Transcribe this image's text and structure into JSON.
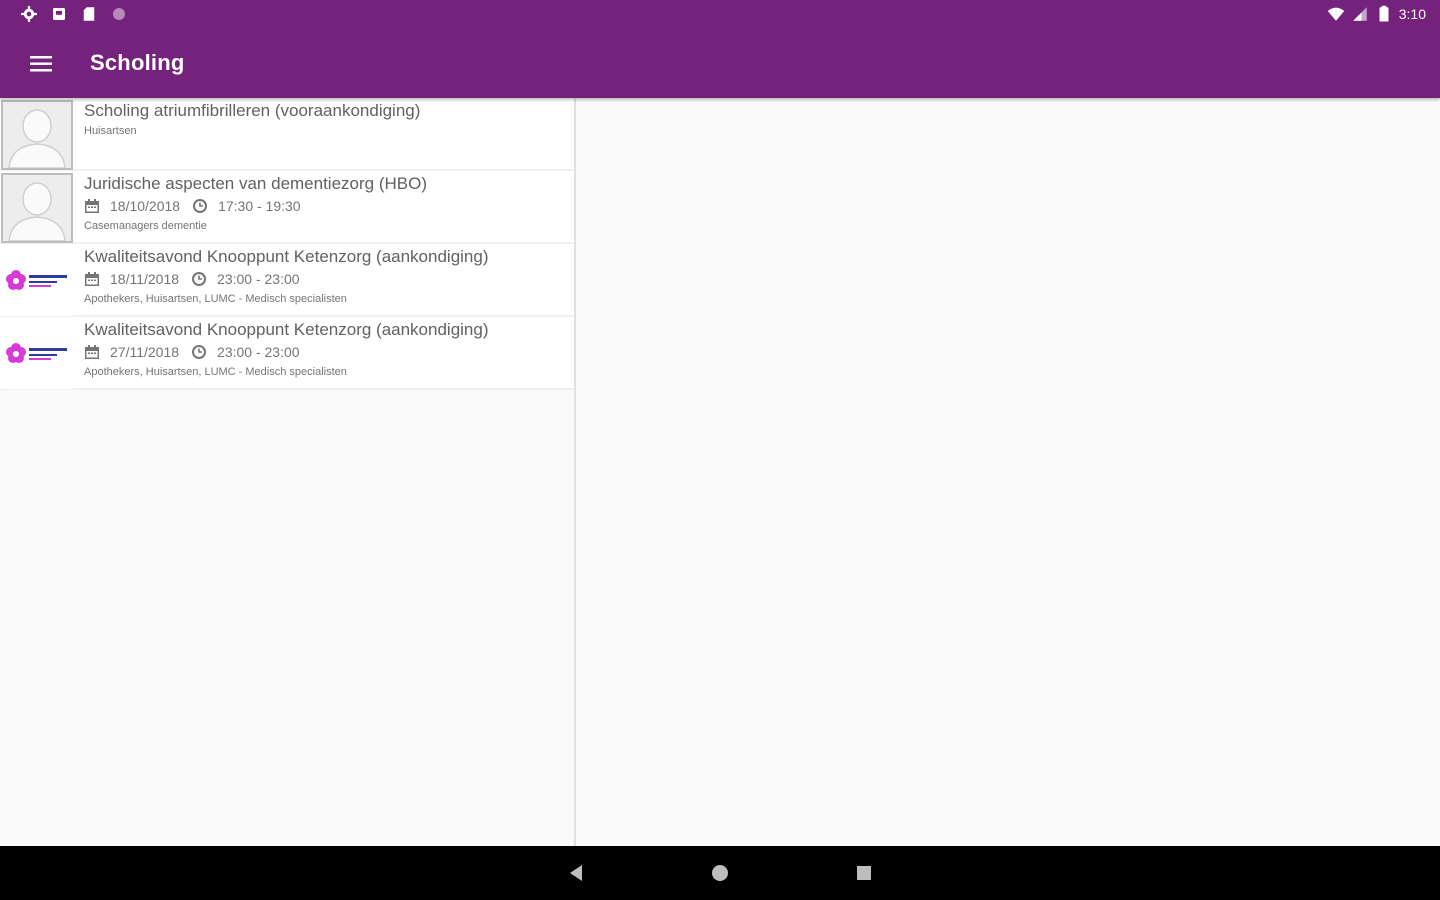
{
  "status_bar": {
    "time": "3:10",
    "left_icons": [
      "settings-icon",
      "notification-icon",
      "sd-card-icon",
      "circle-icon"
    ],
    "right_icons": [
      "wifi-icon",
      "signal-icon",
      "battery-icon"
    ]
  },
  "app_bar": {
    "title": "Scholing",
    "menu_icon": "hamburger-menu-icon"
  },
  "colors": {
    "primary": "#75227c",
    "logo_pink": "#d63bd6",
    "logo_blue": "#2b3c9a"
  },
  "items": [
    {
      "title": "Scholing atriumfibrilleren (vooraankondiging)",
      "date": "",
      "time": "",
      "audience": "Huisartsen",
      "thumbnail": "avatar-placeholder"
    },
    {
      "title": "Juridische aspecten van dementiezorg (HBO)",
      "date": "18/10/2018",
      "time": "17:30 - 19:30",
      "audience": "Casemanagers dementie",
      "thumbnail": "avatar-placeholder"
    },
    {
      "title": "Kwaliteitsavond Knooppunt Ketenzorg (aankondiging)",
      "date": "18/11/2018",
      "time": "23:00 - 23:00",
      "audience": "Apothekers, Huisartsen, LUMC - Medisch specialisten",
      "thumbnail": "knooppunt-logo"
    },
    {
      "title": "Kwaliteitsavond Knooppunt Ketenzorg (aankondiging)",
      "date": "27/11/2018",
      "time": "23:00 - 23:00",
      "audience": "Apothekers, Huisartsen, LUMC - Medisch specialisten",
      "thumbnail": "knooppunt-logo"
    }
  ],
  "nav_bar": {
    "back_icon": "back-triangle-icon",
    "home_icon": "home-circle-icon",
    "recents_icon": "recents-square-icon"
  }
}
